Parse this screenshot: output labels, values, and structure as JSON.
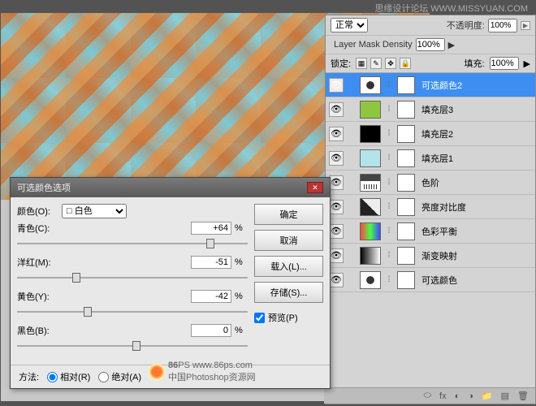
{
  "watermark": {
    "site": "思缘设计论坛",
    "url": "WWW.MISSYUAN.COM"
  },
  "layersPanel": {
    "blendMode": "正常",
    "opacityLabel": "不透明度:",
    "opacityVal": "100%",
    "maskDensityLabel": "Layer Mask Density",
    "maskDensityVal": "100%",
    "lockLabel": "锁定:",
    "fillLabel": "填充:",
    "fillVal": "100%",
    "layers": [
      {
        "name": "可选颜色2",
        "sel": true,
        "thumb": "adj"
      },
      {
        "name": "填充层3",
        "thumb": "green"
      },
      {
        "name": "填充层2",
        "thumb": "black"
      },
      {
        "name": "填充层1",
        "thumb": "lblue"
      },
      {
        "name": "色阶",
        "thumb": "lev"
      },
      {
        "name": "亮度对比度",
        "thumb": "bc"
      },
      {
        "name": "色彩平衡",
        "thumb": "cb"
      },
      {
        "name": "渐变映射",
        "thumb": "grad"
      },
      {
        "name": "可选颜色",
        "thumb": "adj"
      }
    ]
  },
  "dialog": {
    "title": "可选颜色选项",
    "colorLabel": "颜色(O):",
    "colorValue": "白色",
    "sliders": [
      {
        "label": "青色(C):",
        "value": "+64",
        "pos": 82
      },
      {
        "label": "洋红(M):",
        "value": "-51",
        "pos": 24
      },
      {
        "label": "黄色(Y):",
        "value": "-42",
        "pos": 29
      },
      {
        "label": "黑色(B):",
        "value": "0",
        "pos": 50
      }
    ],
    "pct": "%",
    "buttons": {
      "ok": "确定",
      "cancel": "取消",
      "load": "载入(L)...",
      "save": "存储(S)..."
    },
    "preview": "预览(P)",
    "methodLabel": "方法:",
    "relative": "相对(R)",
    "absolute": "绝对(A)"
  },
  "logo": {
    "brand": "86",
    "ps": "PS",
    "site": "www.86ps.com",
    "sub": "中国Photoshop资源网"
  }
}
